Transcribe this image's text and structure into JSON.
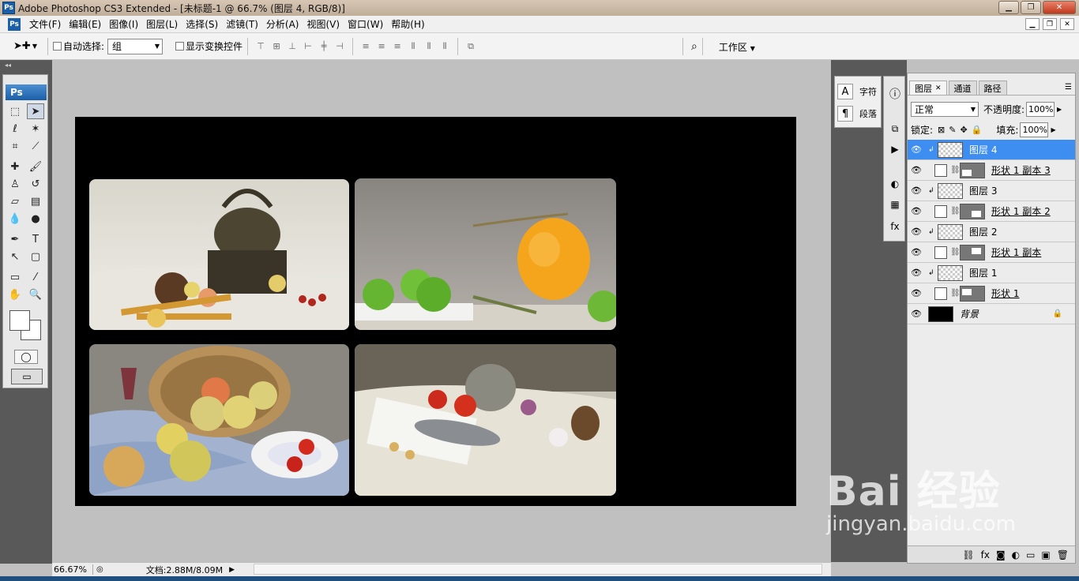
{
  "window": {
    "title": "Adobe Photoshop CS3 Extended - [未标题-1 @ 66.7% (图层 4, RGB/8)]",
    "logo": "Ps"
  },
  "menu": [
    "文件(F)",
    "编辑(E)",
    "图像(I)",
    "图层(L)",
    "选择(S)",
    "滤镜(T)",
    "分析(A)",
    "视图(V)",
    "窗口(W)",
    "帮助(H)"
  ],
  "options": {
    "auto_select_label": "自动选择:",
    "auto_select_value": "组",
    "show_transform_label": "显示变换控件",
    "workspace_label": "工作区"
  },
  "tools": {
    "badge": "Ps",
    "type_tool": "T"
  },
  "status": {
    "zoom": "66.67%",
    "doc_info": "文档:2.88M/8.09M"
  },
  "char_panel": {
    "char_label": "字符",
    "para_label": "段落"
  },
  "layers_panel": {
    "tabs": [
      "图层",
      "通道",
      "路径"
    ],
    "blend_mode": "正常",
    "opacity_label": "不透明度:",
    "opacity": "100%",
    "lock_label": "锁定:",
    "fill_label": "填充:",
    "fill": "100%",
    "layers": [
      {
        "name": "图层 4",
        "type": "image",
        "selected": true
      },
      {
        "name": "形状 1 副本 3",
        "type": "shape"
      },
      {
        "name": "图层 3",
        "type": "image"
      },
      {
        "name": "形状 1 副本 2",
        "type": "shape"
      },
      {
        "name": "图层 2",
        "type": "image"
      },
      {
        "name": "形状 1 副本",
        "type": "shape"
      },
      {
        "name": "图层 1",
        "type": "image"
      },
      {
        "name": "形状 1",
        "type": "shape"
      },
      {
        "name": "背景",
        "type": "background"
      }
    ]
  },
  "watermark": {
    "main": "Bai 经验",
    "sub": "jingyan.baidu.com"
  }
}
